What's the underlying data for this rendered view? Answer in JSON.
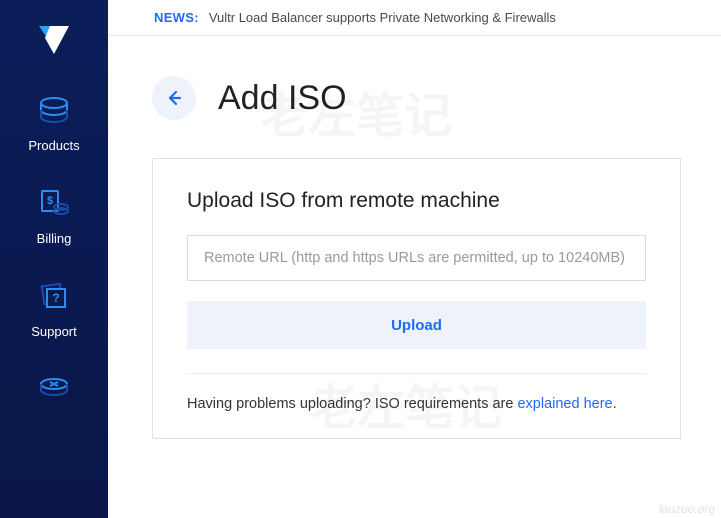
{
  "topbar": {
    "news_label": "NEWS:",
    "news_text": "Vultr Load Balancer supports Private Networking & Firewalls"
  },
  "sidebar": {
    "items": [
      {
        "label": "Products"
      },
      {
        "label": "Billing"
      },
      {
        "label": "Support"
      }
    ]
  },
  "page": {
    "title": "Add ISO"
  },
  "card": {
    "title": "Upload ISO from remote machine",
    "url_placeholder": "Remote URL (http and https URLs are permitted, up to 10240MB)",
    "url_value": "",
    "upload_label": "Upload",
    "help_prefix": "Having problems uploading? ISO requirements are ",
    "help_link": "explained here",
    "help_suffix": "."
  },
  "watermark": "老左笔记",
  "sourcemark": "laozuo.org"
}
